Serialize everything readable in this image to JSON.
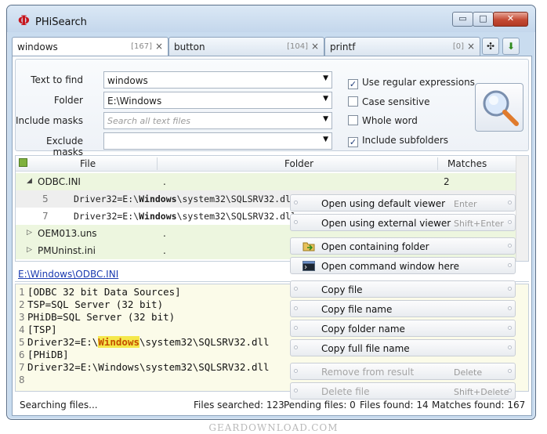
{
  "window": {
    "logo": "Φ",
    "title": "PHiSearch",
    "min": "▭",
    "max": "□",
    "close": "✕"
  },
  "tabs": [
    {
      "label": "windows",
      "count": "[167]",
      "close": "×"
    },
    {
      "label": "button",
      "count": "[104]",
      "close": "×"
    },
    {
      "label": "printf",
      "count": "[0]",
      "close": "×"
    }
  ],
  "tab_extra": {
    "pin": "✣",
    "down": "⬇"
  },
  "search": {
    "text_label": "Text to find",
    "text_value": "windows",
    "folder_label": "Folder",
    "folder_value": "E:\\Windows",
    "include_label": "Include masks",
    "include_placeholder": "Search all text files",
    "exclude_label": "Exclude masks",
    "exclude_value": "",
    "dropdown_arrow": "▼"
  },
  "options": [
    {
      "label": "Use regular expressions",
      "checked": "✓"
    },
    {
      "label": "Case sensitive",
      "checked": ""
    },
    {
      "label": "Whole word",
      "checked": ""
    },
    {
      "label": "Include subfolders",
      "checked": "✓"
    }
  ],
  "grid": {
    "headers": {
      "file": "File",
      "folder": "Folder",
      "matches": "Matches"
    },
    "rows": [
      {
        "name": "ODBC.INI",
        "folder": ".",
        "matches": "2",
        "expand": "◢"
      },
      {
        "line": "5",
        "pre": "Driver32=E:\\",
        "bold": "Windows",
        "post": "\\system32\\SQLSRV32.dll"
      },
      {
        "line": "7",
        "pre": "Driver32=E:\\",
        "bold": "Windows",
        "post": "\\system32\\SQLSRV32.dll"
      },
      {
        "name": "OEM013.uns",
        "folder": ".",
        "expand": "▷"
      },
      {
        "name": "PMUninst.ini",
        "folder": ".",
        "expand": "▷"
      }
    ]
  },
  "path": "E:\\Windows\\ODBC.INI",
  "preview": [
    {
      "n": "1",
      "text": "[ODBC 32 bit Data Sources]"
    },
    {
      "n": "2",
      "text": "TSP=SQL Server (32 bit)"
    },
    {
      "n": "3",
      "text": "PHiDB=SQL Server (32 bit)"
    },
    {
      "n": "4",
      "text": "[TSP]"
    },
    {
      "n": "5",
      "pre": "Driver32=E:\\",
      "hl": "Windows",
      "post": "\\system32\\SQLSRV32.dll"
    },
    {
      "n": "6",
      "text": "[PHiDB]"
    },
    {
      "n": "7",
      "text": "Driver32=E:\\Windows\\system32\\SQLSRV32.dll"
    },
    {
      "n": "8",
      "text": ""
    }
  ],
  "status": {
    "state": "Searching files...",
    "searched": "Files searched: 123",
    "pending": "Pending files: 0",
    "found": "Files found: 14",
    "matches": "Matches found: 167"
  },
  "menu": [
    {
      "label": "Open using default viewer",
      "key": "Enter"
    },
    {
      "label": "Open using external viewer",
      "key": "Shift+Enter"
    },
    {
      "label": "Open containing folder",
      "key": "",
      "icon": "folder-icon"
    },
    {
      "label": "Open command window here",
      "key": "",
      "icon": "terminal-icon"
    },
    {
      "label": "Copy file",
      "key": ""
    },
    {
      "label": "Copy file name",
      "key": ""
    },
    {
      "label": "Copy folder name",
      "key": ""
    },
    {
      "label": "Copy full file name",
      "key": ""
    },
    {
      "label": "Remove from result",
      "key": "Delete",
      "disabled": true
    },
    {
      "label": "Delete file",
      "key": "Shift+Delete",
      "disabled": true
    }
  ],
  "watermark": "GEARDOWNLOAD.COM",
  "colors": {
    "accent_red": "#c8161d",
    "file_row": "#edf6df",
    "highlight": "#f5e84b",
    "link": "#1a3ab0"
  }
}
